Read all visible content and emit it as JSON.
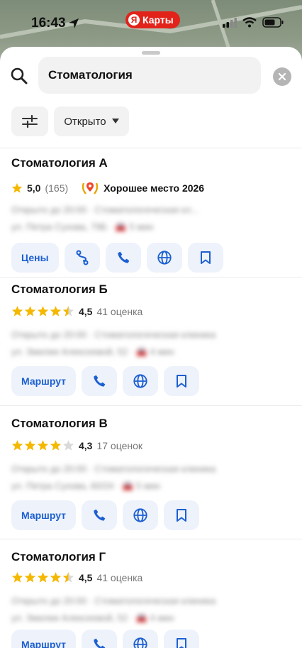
{
  "status_bar": {
    "time": "16:43",
    "app_badge": "Карты",
    "app_badge_letter": "Я"
  },
  "search": {
    "value": "Стоматология"
  },
  "filters": {
    "open_label": "Открыто"
  },
  "results": [
    {
      "title": "Стоматология А",
      "rating": "5,0",
      "reviews": "(165)",
      "stars": 1,
      "award": "Хорошее место 2026",
      "blur_line1": "Открыто до 20:00 · Стоматологическая кл...",
      "blur_line2": "ул. Петра Сухова, 79Б · 🚘 5 мин",
      "primary_action": "Цены"
    },
    {
      "title": "Стоматология Б",
      "rating": "4,5",
      "reviews": "41 оценка",
      "stars": 4.5,
      "blur_line1": "Открыто до 20:00 · Стоматологическая клиника",
      "blur_line2": "ул. Змилии Алексеевой, 52 · 🚘 4 мин",
      "primary_action": "Маршрут"
    },
    {
      "title": "Стоматология В",
      "rating": "4,3",
      "reviews": "17 оценок",
      "stars": 4,
      "blur_line1": "Открыто до 20:00 · Стоматологическая клиника",
      "blur_line2": "ул. Петра Сухова, 60/24 · 🚘 5 мин",
      "primary_action": "Маршрут"
    },
    {
      "title": "Стоматология Г",
      "rating": "4,5",
      "reviews": "41 оценка",
      "stars": 4.5,
      "blur_line1": "Открыто до 20:00 · Стоматологическая клиника",
      "blur_line2": "ул. Змилии Алексеевой, 52 · 🚘 4 мин",
      "primary_action": "Маршрут"
    }
  ],
  "colors": {
    "accent": "#1c5fd1",
    "star": "#f5b800",
    "badge_red": "#e2231a"
  },
  "icons": [
    "search-icon",
    "clear-icon",
    "filter-sliders-icon",
    "chevron-down-icon",
    "route-icon",
    "phone-icon",
    "globe-icon",
    "bookmark-icon",
    "star-icon",
    "award-laurel-icon",
    "location-arrow-icon",
    "signal-icon",
    "wifi-icon",
    "battery-icon"
  ]
}
